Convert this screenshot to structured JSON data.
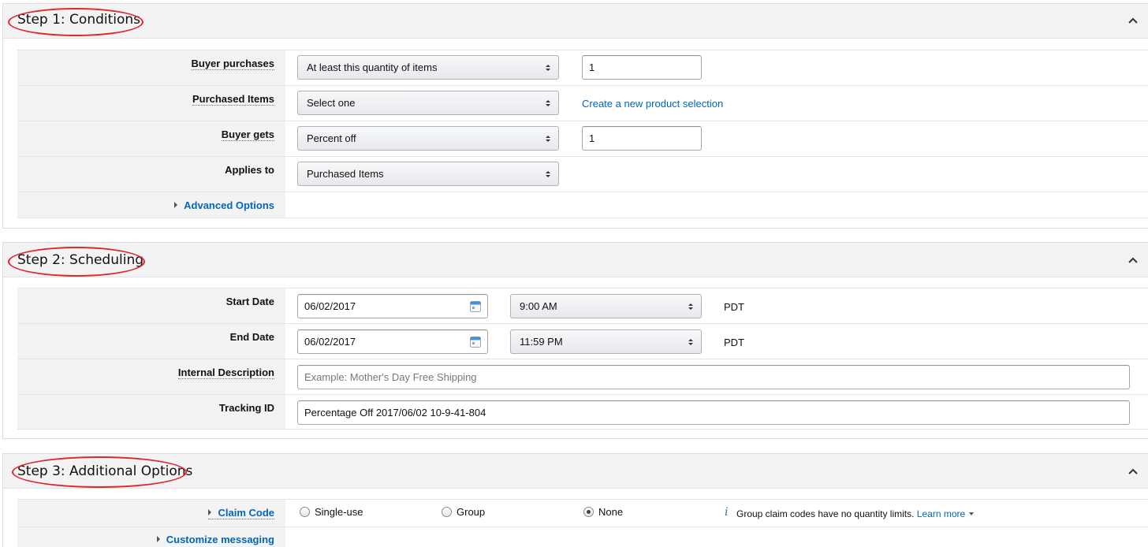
{
  "step1": {
    "title": "Step 1: Conditions",
    "rows": {
      "buyer_purchases": {
        "label": "Buyer purchases",
        "select": "At least this quantity of items",
        "input": "1"
      },
      "purchased_items": {
        "label": "Purchased Items",
        "select": "Select one",
        "link": "Create a new product selection"
      },
      "buyer_gets": {
        "label": "Buyer gets",
        "select": "Percent off",
        "input": "1"
      },
      "applies_to": {
        "label": "Applies to",
        "select": "Purchased Items"
      },
      "advanced": {
        "label": "Advanced Options"
      }
    }
  },
  "step2": {
    "title": "Step 2: Scheduling",
    "rows": {
      "start_date": {
        "label": "Start Date",
        "date": "06/02/2017",
        "time": "9:00 AM",
        "tz": "PDT"
      },
      "end_date": {
        "label": "End Date",
        "date": "06/02/2017",
        "time": "11:59 PM",
        "tz": "PDT"
      },
      "internal_description": {
        "label": "Internal Description",
        "placeholder": "Example: Mother's Day Free Shipping"
      },
      "tracking_id": {
        "label": "Tracking ID",
        "value": "Percentage Off 2017/06/02 10-9-41-804"
      }
    }
  },
  "step3": {
    "title": "Step 3: Additional Options",
    "rows": {
      "claim_code": {
        "label": "Claim Code",
        "options": [
          "Single-use",
          "Group",
          "None"
        ],
        "selected": "None",
        "info": "Group claim codes have no quantity limits.",
        "learn_more": "Learn more"
      },
      "customize": {
        "label": "Customize messaging"
      }
    }
  },
  "colors": {
    "link": "#0066c0",
    "highlight_ellipse": "#e0262b",
    "label_bg": "#f3f3f3"
  },
  "icons": [
    "chevron-up-icon",
    "calendar-icon",
    "select-arrows-icon",
    "expand-triangle-icon",
    "info-icon"
  ]
}
